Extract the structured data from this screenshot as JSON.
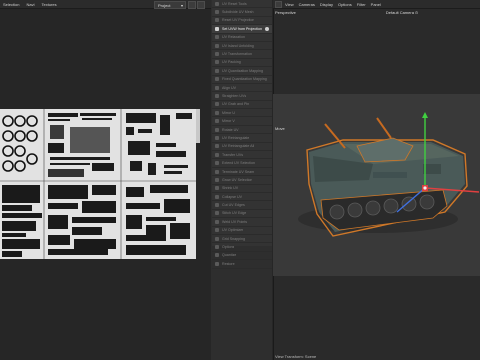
{
  "uv_editor": {
    "menu": [
      "Selection",
      "Navi",
      "Textures"
    ],
    "dropdown_value": "Project",
    "colors": {
      "sheet_bg": "#dadada",
      "island": "#1c1c1c"
    }
  },
  "tools": {
    "items": [
      {
        "label": "UV Reset Tools",
        "icon": "tool-icon"
      },
      {
        "label": "Subdivide UV Mesh",
        "icon": "tool-icon"
      },
      {
        "label": "Reset UV Projection",
        "icon": "tool-icon"
      },
      {
        "label": "Set UVW from Projection",
        "icon": "projection-icon",
        "active": true
      },
      {
        "label": "UV Relaxation",
        "icon": "tool-icon"
      },
      {
        "label": "UV Island Unfolding",
        "icon": "tool-icon"
      },
      {
        "label": "UV Transformation",
        "icon": "tool-icon"
      },
      {
        "label": "UV Packing",
        "icon": "tool-icon"
      },
      {
        "label": "UV Quantization Mapping",
        "icon": "tool-icon"
      },
      {
        "label": "Fixed Quantization Mapping",
        "icon": "tool-icon"
      },
      {
        "label": "Align UV",
        "icon": "tool-icon"
      },
      {
        "label": "Straighten UVs",
        "icon": "tool-icon"
      },
      {
        "label": "UV Grab and Pin",
        "icon": "tool-icon"
      },
      {
        "label": "Mirror U",
        "icon": "tool-icon"
      },
      {
        "label": "Mirror V",
        "icon": "tool-icon"
      },
      {
        "label": "Rotate UV",
        "icon": "tool-icon"
      },
      {
        "label": "UV Retriangulate",
        "icon": "tool-icon"
      },
      {
        "label": "UV Retriangulate All",
        "icon": "tool-icon"
      },
      {
        "label": "Transfer UVs",
        "icon": "tool-icon"
      },
      {
        "label": "Extend UV Selection",
        "icon": "tool-icon"
      },
      {
        "label": "Terminate UV Seam",
        "icon": "tool-icon"
      },
      {
        "label": "Grow UV Selection",
        "icon": "tool-icon"
      },
      {
        "label": "Shrink UV",
        "icon": "tool-icon"
      },
      {
        "label": "Collapse UV",
        "icon": "tool-icon"
      },
      {
        "label": "Cut UV Edges",
        "icon": "tool-icon"
      },
      {
        "label": "Stitch UV Edge",
        "icon": "tool-icon"
      },
      {
        "label": "Weld UV Points",
        "icon": "tool-icon"
      },
      {
        "label": "UV Optimizer",
        "icon": "tool-icon"
      },
      {
        "label": "Grid Snapping",
        "icon": "tool-icon"
      },
      {
        "label": "Options",
        "icon": "tool-icon"
      },
      {
        "label": "Quantize",
        "icon": "tool-icon"
      },
      {
        "label": "Restore",
        "icon": "tool-icon"
      }
    ]
  },
  "viewport": {
    "menu": [
      "View",
      "Cameras",
      "Display",
      "Options",
      "Filter",
      "Panel"
    ],
    "view_name": "Perspective",
    "camera": "Default Camera",
    "object_label": "Move",
    "footer": "View Transform: Scene",
    "colors": {
      "bg": "#393939",
      "tank_body": "#4a5a58",
      "track": "#2a2a2a",
      "outline": "#d07828",
      "axis_x": "#e04040",
      "axis_y": "#40d040",
      "axis_z": "#4070e0"
    }
  }
}
